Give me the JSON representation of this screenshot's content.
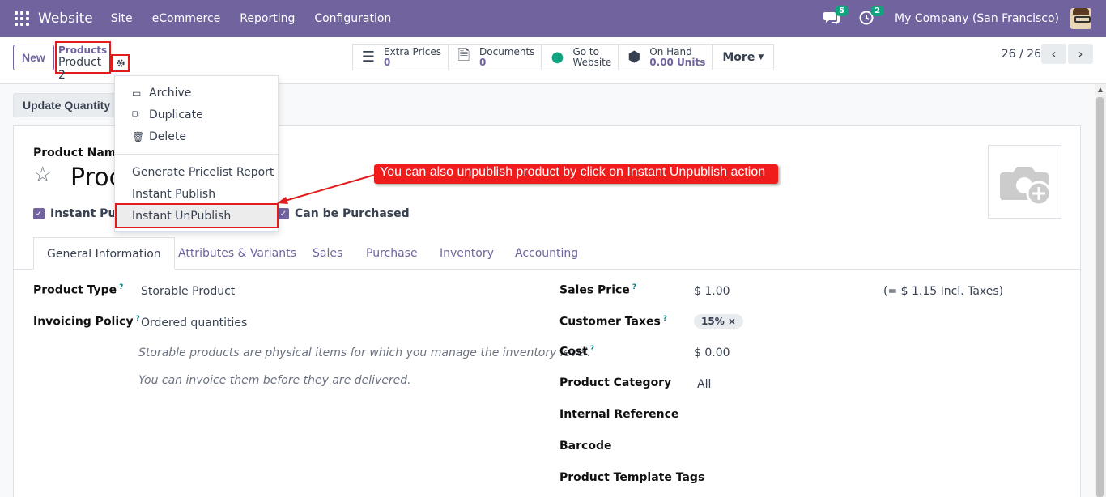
{
  "navbar": {
    "brand": "Website",
    "menu": [
      "Site",
      "eCommerce",
      "Reporting",
      "Configuration"
    ],
    "messages_count": "5",
    "activities_count": "2",
    "company": "My Company (San Francisco)"
  },
  "control": {
    "new_label": "New",
    "breadcrumb_parent": "Products",
    "breadcrumb_current": "Product 2",
    "smart_buttons": [
      {
        "icon": "list-icon",
        "label": "Extra Prices",
        "value": "0"
      },
      {
        "icon": "document-icon",
        "label": "Documents",
        "value": "0"
      },
      {
        "icon": "globe-icon",
        "label": "Go to",
        "value": "Website"
      },
      {
        "icon": "cubes-icon",
        "label": "On Hand",
        "value": "0.00 Units"
      }
    ],
    "more_label": "More",
    "pager": "26 / 26"
  },
  "status_bar": {
    "update_quantity": "Update Quantity"
  },
  "dropdown": {
    "archive": "Archive",
    "duplicate": "Duplicate",
    "delete": "Delete",
    "pricelist_report": "Generate Pricelist Report",
    "instant_publish": "Instant Publish",
    "instant_unpublish": "Instant UnPublish"
  },
  "callout": "You can also unpublish product by click on Instant Unpublish action",
  "form": {
    "product_name_label": "Product Name",
    "product_name_value": "Proc",
    "instant_publish_check": "Instant Publi",
    "can_be_purchased": "Can be Purchased",
    "tabs": [
      "General Information",
      "Attributes & Variants",
      "Sales",
      "Purchase",
      "Inventory",
      "Accounting"
    ],
    "left": {
      "product_type_label": "Product Type",
      "product_type_value": "Storable Product",
      "invoicing_label": "Invoicing Policy",
      "invoicing_value": "Ordered quantities",
      "help1": "Storable products are physical items for which you manage the inventory level.",
      "help2": "You can invoice them before they are delivered."
    },
    "right": {
      "sales_price_label": "Sales Price",
      "sales_price_value": "$ 1.00",
      "incl_taxes": "(= $ 1.15 Incl. Taxes)",
      "customer_taxes_label": "Customer Taxes",
      "customer_taxes_tag": "15%",
      "cost_label": "Cost",
      "cost_value": "$ 0.00",
      "category_label": "Product Category",
      "category_value": "All",
      "internal_ref_label": "Internal Reference",
      "barcode_label": "Barcode",
      "tags_label": "Product Template Tags"
    },
    "help_marker": "?"
  }
}
